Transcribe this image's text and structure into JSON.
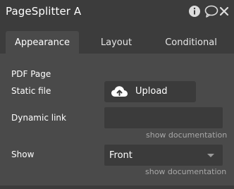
{
  "window": {
    "title": "PageSplitter A"
  },
  "toolbar": {
    "icons": [
      "info-icon",
      "comment-icon",
      "close-icon"
    ]
  },
  "tabs": [
    {
      "label": "Appearance",
      "active": true
    },
    {
      "label": "Layout",
      "active": false
    },
    {
      "label": "Conditional",
      "active": false
    }
  ],
  "fields": {
    "section_label": "PDF Page",
    "static_file_label": "Static file",
    "upload_label": "Upload",
    "dynamic_link_label": "Dynamic link",
    "dynamic_link_value": "",
    "show_label": "Show",
    "show_value": "Front",
    "show_documentation": "show documentation"
  },
  "colors": {
    "panel_bg": "#4a4a4a",
    "header_bg": "#3c3c3c",
    "field_bg": "#3b3b3b",
    "muted_text": "#a8a8a8"
  }
}
